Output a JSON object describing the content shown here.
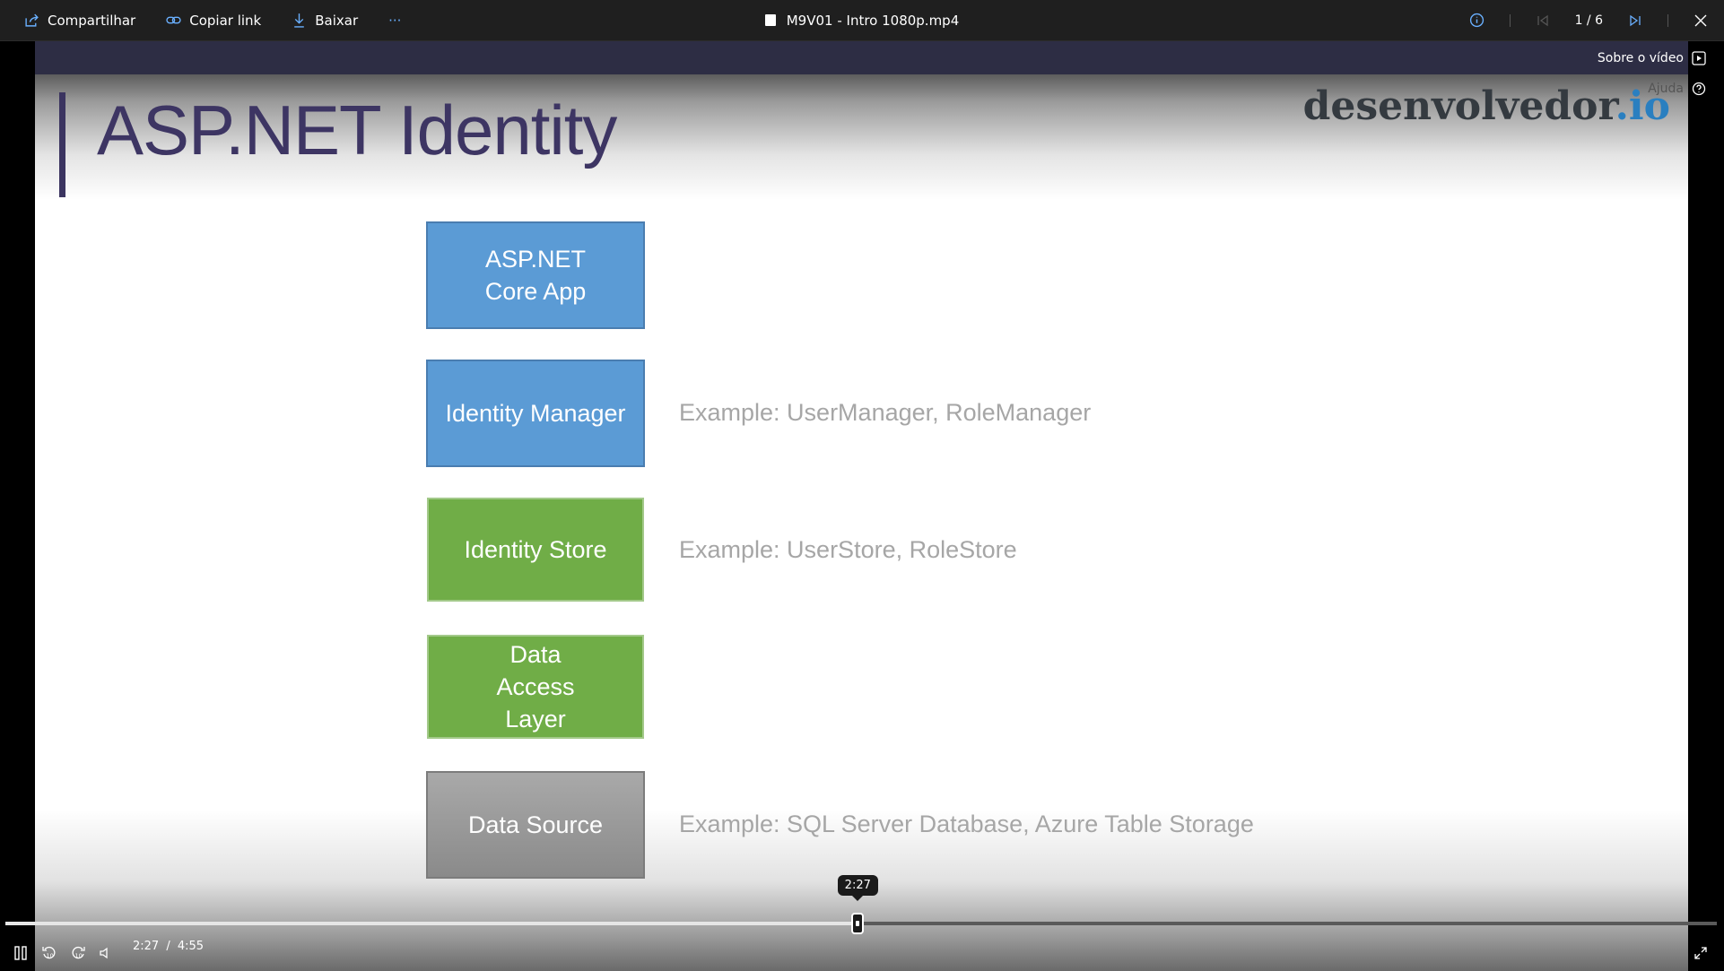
{
  "toolbar": {
    "share_label": "Compartilhar",
    "copy_link_label": "Copiar link",
    "download_label": "Baixar",
    "more_label": "···",
    "file_title": "M9V01 - Intro 1080p.mp4",
    "page_indicator": "1 / 6",
    "icons": [
      "share-icon",
      "link-icon",
      "download-icon",
      "more-icon",
      "info-icon",
      "first-page-icon",
      "last-page-icon",
      "close-icon"
    ]
  },
  "side_panel": {
    "about_video_label": "Sobre o vídeo",
    "help_label": "Ajuda"
  },
  "slide": {
    "title": "ASP.NET Identity",
    "logo_main": "desenvolvedor",
    "logo_suffix": ".io",
    "layers": [
      {
        "label": "ASP.NET Core App",
        "color": "#5b9bd5",
        "example": ""
      },
      {
        "label": "Identity Manager",
        "color": "#5b9bd5",
        "example": "Example: UserManager, RoleManager"
      },
      {
        "label": "Identity Store",
        "color": "#70ad47",
        "example": "Example: UserStore, RoleStore"
      },
      {
        "label": "Data Access Layer",
        "color": "#70ad47",
        "example": ""
      },
      {
        "label": "Data Source",
        "color": "#a6a6a6",
        "example": "Example: SQL Server Database, Azure Table Storage"
      }
    ]
  },
  "player": {
    "current_time": "2:27",
    "duration": "4:55",
    "time_separator": "/",
    "tooltip_time": "2:27",
    "progress_fraction": 0.498,
    "controls": [
      "pause-icon",
      "rewind-10-icon",
      "forward-10-icon",
      "volume-icon",
      "fullscreen-icon"
    ]
  }
}
